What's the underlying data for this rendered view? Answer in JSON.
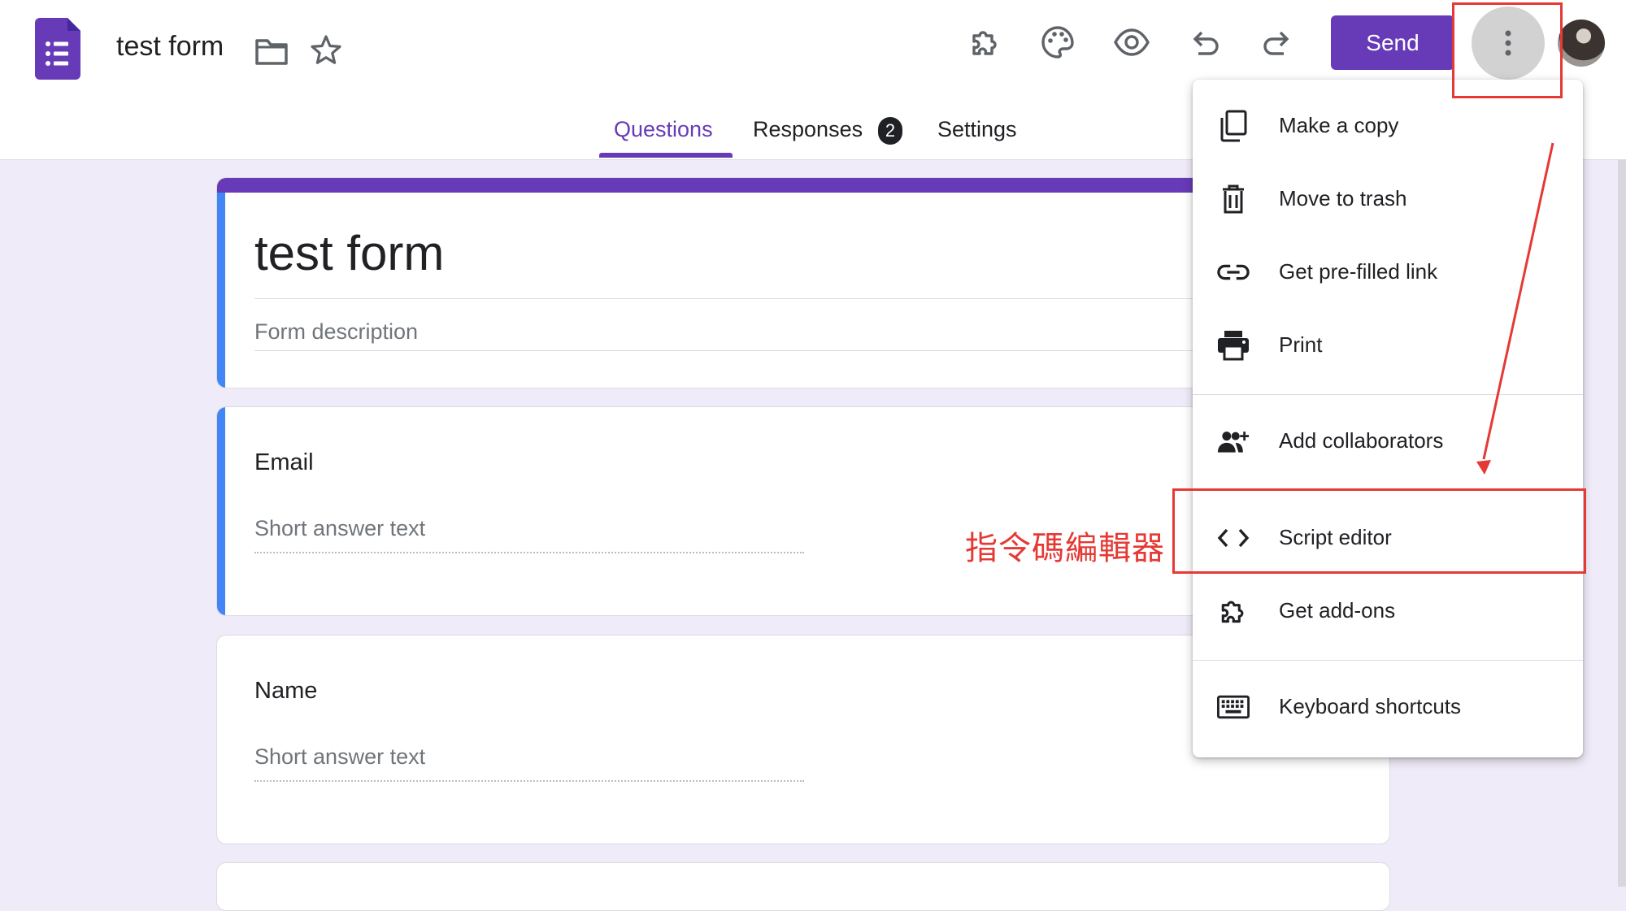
{
  "header": {
    "doc_title": "test form",
    "send_label": "Send",
    "icons": [
      "addon-icon",
      "palette-icon",
      "preview-eye-icon",
      "undo-icon",
      "redo-icon",
      "more-vert-icon"
    ]
  },
  "tabs": [
    {
      "label": "Questions",
      "active": true
    },
    {
      "label": "Responses",
      "badge": "2"
    },
    {
      "label": "Settings"
    }
  ],
  "form": {
    "title": "test form",
    "description_placeholder": "Form description",
    "questions": [
      {
        "title": "Email",
        "answer_placeholder": "Short answer text"
      },
      {
        "title": "Name",
        "answer_placeholder": "Short answer text"
      }
    ]
  },
  "menu": {
    "items": [
      {
        "label": "Make a copy",
        "icon": "copy-icon"
      },
      {
        "label": "Move to trash",
        "icon": "trash-icon"
      },
      {
        "label": "Get pre-filled link",
        "icon": "link-icon"
      },
      {
        "label": "Print",
        "icon": "print-icon"
      },
      {
        "label": "Add collaborators",
        "icon": "add-people-icon"
      },
      {
        "label": "Script editor",
        "icon": "code-icon"
      },
      {
        "label": "Get add-ons",
        "icon": "addon-icon"
      },
      {
        "label": "Keyboard shortcuts",
        "icon": "keyboard-icon"
      }
    ]
  },
  "annotation": {
    "label": "指令碼編輯器",
    "color": "#e53935"
  },
  "colors": {
    "brand": "#673ab7",
    "accent_left": "#4285f4",
    "background": "#f0ebf8"
  }
}
